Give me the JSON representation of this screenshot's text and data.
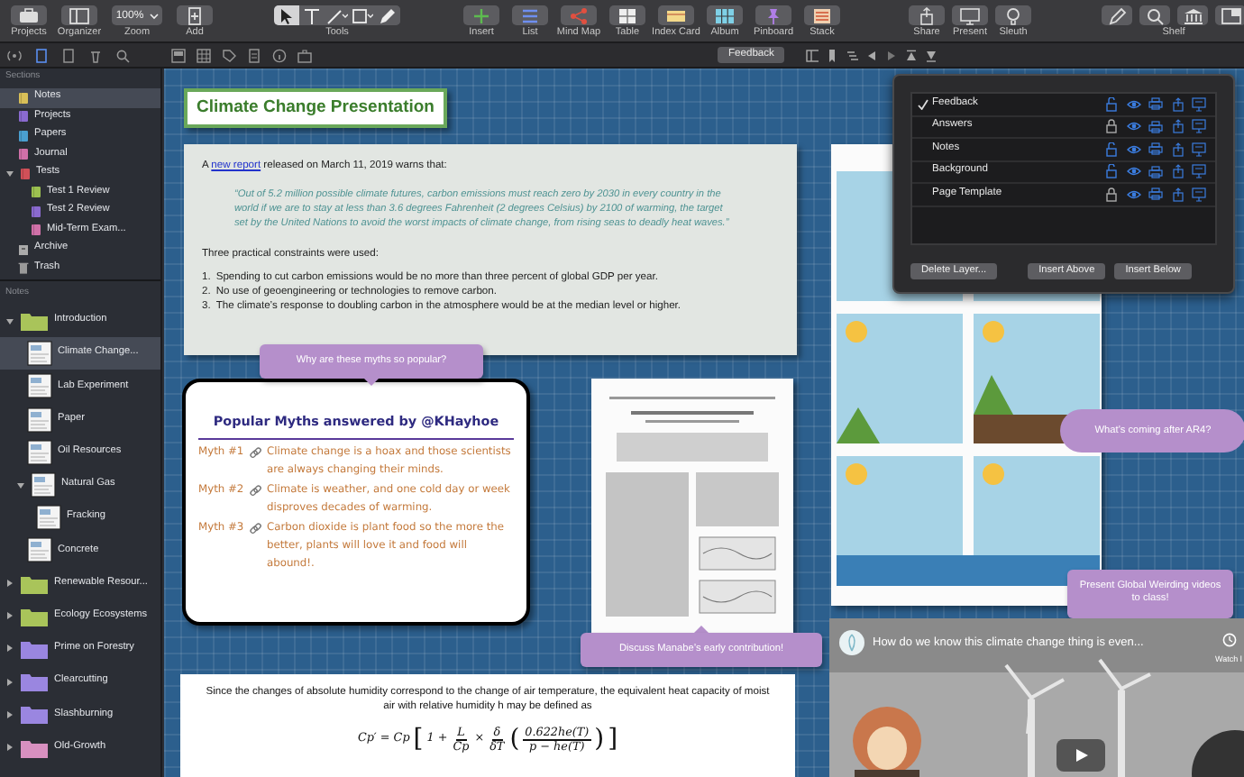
{
  "toolbar": {
    "left": [
      {
        "kind": "projects",
        "label": "Projects"
      },
      {
        "kind": "organizer",
        "label": "Organizer"
      },
      {
        "kind": "zoom",
        "label": "Zoom",
        "value": "100%"
      },
      {
        "kind": "add",
        "label": "Add"
      }
    ],
    "tools": {
      "label": "Tools",
      "items": [
        {
          "kind": "pointer",
          "selected": true
        },
        {
          "kind": "text",
          "selected": false
        },
        {
          "kind": "line",
          "selected": false
        },
        {
          "kind": "shape",
          "selected": false
        },
        {
          "kind": "pen",
          "selected": false
        }
      ]
    },
    "insert": [
      {
        "kind": "insert",
        "label": "Insert"
      },
      {
        "kind": "list",
        "label": "List"
      },
      {
        "kind": "mindmap",
        "label": "Mind Map"
      },
      {
        "kind": "table",
        "label": "Table"
      },
      {
        "kind": "indexcard",
        "label": "Index Card"
      },
      {
        "kind": "album",
        "label": "Album"
      },
      {
        "kind": "pinboard",
        "label": "Pinboard"
      },
      {
        "kind": "stack",
        "label": "Stack"
      }
    ],
    "share": [
      {
        "kind": "share",
        "label": "Share"
      },
      {
        "kind": "present",
        "label": "Present"
      },
      {
        "kind": "sleuth",
        "label": "Sleuth"
      }
    ],
    "shelf": {
      "label": "Shelf",
      "items": [
        {
          "kind": "pen"
        },
        {
          "kind": "search"
        },
        {
          "kind": "library"
        },
        {
          "kind": "panel"
        }
      ]
    }
  },
  "layer_button": "Feedback",
  "sidebar": {
    "sections_header": "Sections",
    "sections": [
      {
        "kind": "notebook",
        "label": "Notes",
        "color": "#d8bf58",
        "selected": true
      },
      {
        "kind": "notebook",
        "label": "Projects",
        "color": "#8a6ad0",
        "selected": false
      },
      {
        "kind": "notebook",
        "label": "Papers",
        "color": "#4a9fd0",
        "selected": false
      },
      {
        "kind": "notebook",
        "label": "Journal",
        "color": "#d070a8",
        "selected": false
      },
      {
        "kind": "notebook",
        "label": "Tests",
        "color": "#d05058",
        "selected": false,
        "expanded": true,
        "children": [
          {
            "kind": "notebook",
            "label": "Test 1 Review",
            "color": "#9cc050",
            "selected": false
          },
          {
            "kind": "notebook",
            "label": "Test 2 Review",
            "color": "#8a6ad0",
            "selected": false
          },
          {
            "kind": "notebook",
            "label": "Mid-Term Exam...",
            "color": "#d070a8",
            "selected": false
          }
        ]
      },
      {
        "kind": "archive",
        "label": "Archive",
        "selected": false
      },
      {
        "kind": "trash",
        "label": "Trash",
        "selected": false
      }
    ],
    "notes_header": "Notes",
    "notes": [
      {
        "kind": "folder",
        "label": "Introduction",
        "color": "#a9c45a",
        "selected": false,
        "expanded": true,
        "children": [
          {
            "kind": "page",
            "label": "Climate Change...",
            "selected": true
          },
          {
            "kind": "page",
            "label": "Lab Experiment",
            "selected": false
          },
          {
            "kind": "page",
            "label": "Paper",
            "selected": false
          },
          {
            "kind": "page",
            "label": "Oil Resources",
            "selected": false
          },
          {
            "kind": "page",
            "label": "Natural Gas",
            "selected": false,
            "expanded": true,
            "children": [
              {
                "kind": "page",
                "label": "Fracking",
                "selected": false
              }
            ]
          },
          {
            "kind": "page",
            "label": "Concrete",
            "selected": false
          }
        ]
      },
      {
        "kind": "folder",
        "label": "Renewable Resour...",
        "color": "#a9c45a",
        "selected": false,
        "expanded": false
      },
      {
        "kind": "folder",
        "label": "Ecology Ecosystems",
        "color": "#a9c45a",
        "selected": false,
        "expanded": false
      },
      {
        "kind": "folder",
        "label": "Prime on Forestry",
        "color": "#9a86e0",
        "selected": false,
        "expanded": false
      },
      {
        "kind": "folder",
        "label": "Clearcutting",
        "color": "#9a86e0",
        "selected": false,
        "expanded": false
      },
      {
        "kind": "folder",
        "label": "Slashburning",
        "color": "#9a86e0",
        "selected": false,
        "expanded": false
      },
      {
        "kind": "folder",
        "label": "Old-Growth",
        "color": "#d890c0",
        "selected": false,
        "expanded": false
      }
    ]
  },
  "canvas": {
    "title": "Climate Change Presentation",
    "report": {
      "intro_before": "A ",
      "link": "new report",
      "intro_after": " released on March 11, 2019 warns that:",
      "quote": "“Out of 5.2 million possible climate futures, carbon emissions must reach zero by 2030 in every country in the world if we are to stay at less than 3.6 degrees Fahrenheit (2 degrees Celsius) by 2100 of warming, the target set by the United Nations to avoid the worst impacts of climate change, from rising seas to deadly heat waves.”",
      "constraints_intro": "Three practical constraints were used:",
      "constraints": [
        {
          "number": "1.",
          "text": "Spending to cut carbon emissions would be no more than three percent of global GDP per year."
        },
        {
          "number": "2.",
          "text": "No use of geoengineering or technologies to remove carbon."
        },
        {
          "number": "3.",
          "text": "The climate’s response to doubling carbon in the atmosphere would be at the median level or higher."
        }
      ]
    },
    "myths": {
      "callout": "Why are these myths so popular?",
      "heading": "Popular Myths answered by @KHayhoe",
      "items": [
        {
          "label": "Myth #1",
          "text": "Climate change is a hoax and those scientists are always changing their minds."
        },
        {
          "label": "Myth #2",
          "text": "Climate is weather, and one cold day or week disproves decades of warming."
        },
        {
          "label": "Myth #3",
          "text": "Carbon dioxide is plant food so the more the better, plants will love it and food will abound!."
        }
      ]
    },
    "paper": {
      "kind": "picture",
      "callout": "Discuss Manabe’s early contribution!"
    },
    "formula_note": {
      "text": "Since the changes of absolute humidity correspond to the change of air temperature, the equivalent heat capacity of moist air with relative humidity h may be defined as",
      "formula": [
        {
          "kind": "text",
          "text": "Cp′ = Cp"
        },
        {
          "kind": "bracket",
          "text": "["
        },
        {
          "kind": "text",
          "text": "1 +"
        },
        {
          "kind": "frac",
          "num": "L",
          "den": "Cp"
        },
        {
          "kind": "text",
          "text": "×"
        },
        {
          "kind": "frac",
          "num": "δ",
          "den": "δT"
        },
        {
          "kind": "bracket",
          "text": "("
        },
        {
          "kind": "frac",
          "num": "0.622he(T)",
          "den": "p − he(T)"
        },
        {
          "kind": "bracket",
          "text": ")"
        },
        {
          "kind": "bracket",
          "text": "]"
        }
      ]
    },
    "ar4_callout": "What’s coming after AR4?",
    "video_callout": "Present Global Weirding videos to class!",
    "video": {
      "title": "How do we know this climate change thing is even...",
      "watch_later": "Watch l"
    }
  },
  "layers_popup": {
    "layers": [
      {
        "name": "Feedback",
        "checked": true,
        "locked": false
      },
      {
        "name": "Answers",
        "checked": false,
        "locked": true
      },
      {
        "name": "Notes",
        "checked": false,
        "locked": false
      },
      {
        "name": "Background",
        "checked": false,
        "locked": false
      },
      {
        "name": "Page Template",
        "checked": false,
        "locked": true
      }
    ],
    "buttons": [
      "Delete Layer...",
      "Insert Above",
      "Insert Below"
    ]
  }
}
